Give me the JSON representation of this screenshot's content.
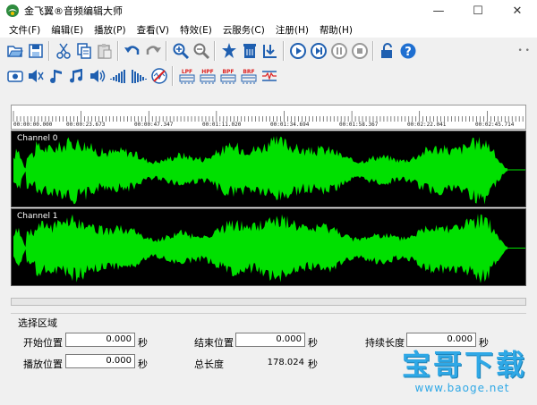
{
  "window": {
    "title": "金飞翼®音频编辑大师"
  },
  "menu": [
    "文件(F)",
    "编辑(E)",
    "播放(P)",
    "查看(V)",
    "特效(E)",
    "云服务(C)",
    "注册(H)",
    "帮助(H)"
  ],
  "timeline": {
    "labels": [
      "00:00:00.000",
      "00:00:23.673",
      "00:00:47.347",
      "00:01:11.020",
      "00:01:34.694",
      "00:01:58.367",
      "00:02:22.041",
      "00:02:45.714"
    ]
  },
  "channels": [
    "Channel 0",
    "Channel 1"
  ],
  "colors": {
    "waveform": "#00e000",
    "wave_bg": "#000000",
    "accent": "#1f6fd1"
  },
  "selection": {
    "group_title": "选择区域",
    "start_label": "开始位置",
    "start_value": "0.000",
    "end_label": "结束位置",
    "end_value": "0.000",
    "duration_label": "持续长度",
    "duration_value": "0.000",
    "play_label": "播放位置",
    "play_value": "0.000",
    "total_label": "总长度",
    "total_value": "178.024",
    "unit": "秒"
  },
  "watermark": {
    "main": "宝哥下载",
    "url": "www.baoge.net"
  }
}
